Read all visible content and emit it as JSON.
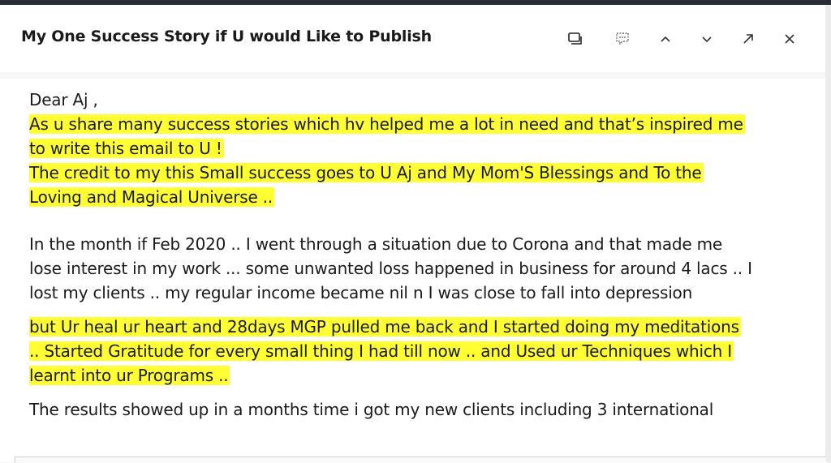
{
  "email": {
    "subject": "My One Success Story if U would Like to Publish",
    "toolbar": {
      "icons": [
        "popout-window-icon",
        "comment-icon",
        "chevron-up-icon",
        "chevron-down-icon",
        "expand-arrow-icon",
        "close-icon"
      ]
    },
    "body": {
      "greeting": "Dear Aj ,",
      "p1": [
        "As u share many success stories which hv helped me a lot in need and that’s inspired me",
        "to write this email to U !",
        "The credit to my this Small success goes to U Aj and My Mom'S Blessings and To the",
        "Loving and Magical Universe .."
      ],
      "p2": [
        "In the month if Feb 2020 .. I went through a situation due to Corona and that made me",
        "lose interest in my work ... some unwanted loss happened in business for around 4 lacs .. I",
        "lost my clients .. my regular income became nil n I was close to fall into depression"
      ],
      "p3": [
        "but Ur heal ur heart and 28days MGP pulled me back and I started doing my meditations",
        ".. Started Gratitude for every small thing I had till now .. and Used ur Techniques which I",
        "learnt into ur Programs .."
      ],
      "p4": [
        "The results showed up in a months time i got my new clients including 3 international"
      ]
    },
    "highlight_color": "#ffff33"
  }
}
